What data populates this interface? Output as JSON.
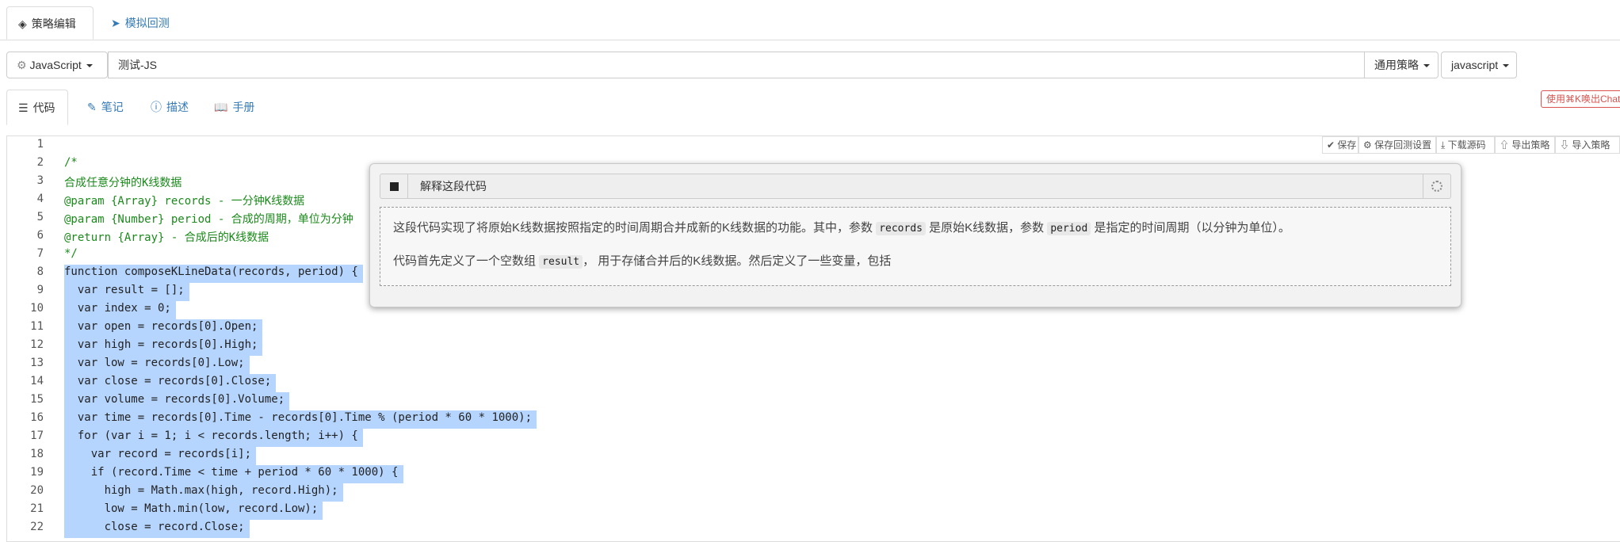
{
  "top_tabs": [
    {
      "label": "策略编辑",
      "icon": "cubes-icon",
      "active": true
    },
    {
      "label": "模拟回测",
      "icon": "rocket-icon",
      "active": false
    }
  ],
  "strategy": {
    "language_label": "JavaScript",
    "name_value": "测试-JS",
    "type_label": "通用策略",
    "syntax_label": "javascript"
  },
  "sub_tabs": [
    {
      "label": "代码",
      "icon": "list-icon"
    },
    {
      "label": "笔记",
      "icon": "edit-icon"
    },
    {
      "label": "描述",
      "icon": "info-icon"
    },
    {
      "label": "手册",
      "icon": "book-icon"
    }
  ],
  "chat_hint": "使用⌘K唤出Chat",
  "toolbar": {
    "save": "保存",
    "save_backtest": "保存回测设置",
    "download": "下载源码",
    "export": "导出策略",
    "import": "导入策略"
  },
  "line_numbers": [
    "1",
    "2",
    "3",
    "4",
    "5",
    "6",
    "7",
    "8",
    "9",
    "10",
    "11",
    "12",
    "13",
    "14",
    "15",
    "16",
    "17",
    "18",
    "19",
    "20",
    "21",
    "22"
  ],
  "code_lines": [
    "",
    "/*",
    "合成任意分钟的K线数据",
    "@param {Array} records - 一分钟K线数据",
    "@param {Number} period - 合成的周期，单位为分钟",
    "@return {Array} - 合成后的K线数据",
    "*/",
    "function composeKLineData(records, period) {",
    "  var result = [];",
    "  var index = 0;",
    "  var open = records[0].Open;",
    "  var high = records[0].High;",
    "  var low = records[0].Low;",
    "  var close = records[0].Close;",
    "  var volume = records[0].Volume;",
    "  var time = records[0].Time - records[0].Time % (period * 60 * 1000);",
    "  for (var i = 1; i < records.length; i++) {",
    "    var record = records[i];",
    "    if (record.Time < time + period * 60 * 1000) {",
    "      high = Math.max(high, record.High);",
    "      low = Math.min(low, record.Low);",
    "      close = record.Close;"
  ],
  "popup": {
    "title": "解释这段代码",
    "para1_a": "这段代码实现了将原始K线数据按照指定的时间周期合并成新的K线数据的功能。其中，参数 ",
    "para1_code1": "records",
    "para1_b": " 是原始K线数据，参数 ",
    "para1_code2": "period",
    "para1_c": " 是指定的时间周期（以分钟为单位）。",
    "para2_a": "代码首先定义了一个空数组 ",
    "para2_code": "result",
    "para2_b": "， 用于存储合并后的K线数据。然后定义了一些变量，包括"
  }
}
